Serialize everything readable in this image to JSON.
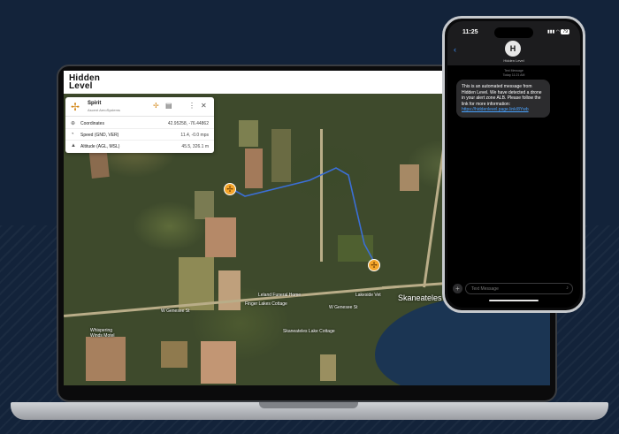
{
  "app": {
    "logo_line1": "Hidden",
    "logo_line2": "Level"
  },
  "drone_panel": {
    "name": "Spirit",
    "manufacturer": "Ascent AeroSystems",
    "rows": [
      {
        "icon": "crosshair-icon",
        "label": "Coordinates",
        "value": "42.95258, -76.44862"
      },
      {
        "icon": "speedometer-icon",
        "label": "Speed (GND, VER)",
        "value": "11.4, -0.0 mps"
      },
      {
        "icon": "altitude-icon",
        "label": "Altitude (AGL, MSL)",
        "value": "45.5, 326.1 m"
      }
    ]
  },
  "map": {
    "town": "Skaneateles",
    "labels": [
      "W Genesee St",
      "Whispering Winds Motel",
      "Finger Lakes Cottage",
      "Leland Funeral Home",
      "Skaneateles Lake Cottage",
      "W Genesee St",
      "Lakeside Vet"
    ],
    "flight_path_color": "#3b6fd6",
    "marker_color": "#f4a52a"
  },
  "phone": {
    "time": "11:25",
    "battery": "79",
    "contact_initial": "H",
    "contact_name": "Hidden Level",
    "message_type": "Text Message",
    "message_time": "Today 11:21 AM",
    "message_text": "This is an automated message from Hidden Level. We have detected a drone in your alert zone ALB. Please follow the link for more information:",
    "message_link": "https://hiddenlevel.page.link/8Ywb",
    "compose_placeholder": "Text Message"
  }
}
